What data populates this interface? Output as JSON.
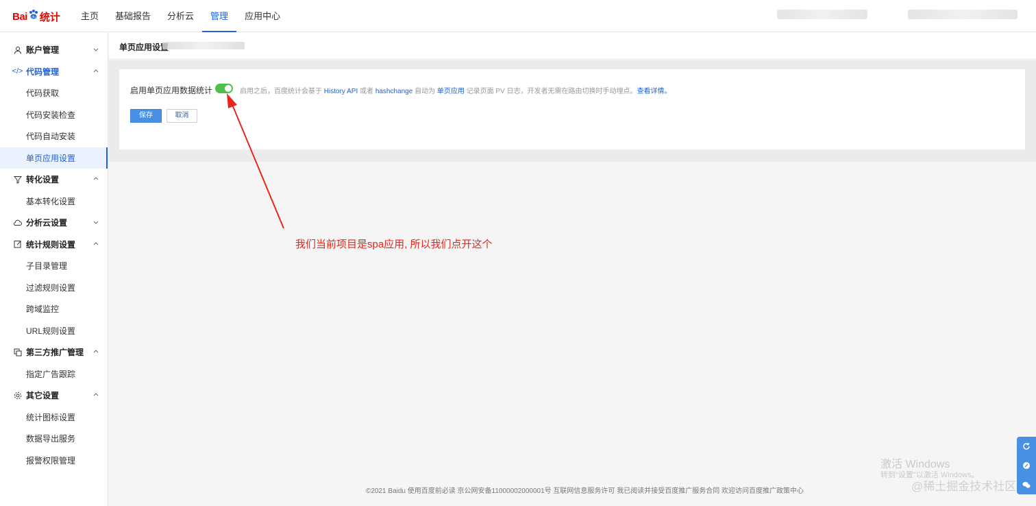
{
  "logo": {
    "left": "Bai",
    "right": "统计"
  },
  "nav": {
    "items": [
      "主页",
      "基础报告",
      "分析云",
      "管理",
      "应用中心"
    ],
    "active_index": 3
  },
  "sidebar": {
    "groups": [
      {
        "label": "账户管理",
        "icon": "user-icon",
        "expanded": false,
        "items": []
      },
      {
        "label": "代码管理",
        "icon": "code-icon",
        "expanded": true,
        "items": [
          "代码获取",
          "代码安装检查",
          "代码自动安装",
          "单页应用设置"
        ]
      },
      {
        "label": "转化设置",
        "icon": "filter-icon",
        "expanded": true,
        "items": [
          "基本转化设置"
        ]
      },
      {
        "label": "分析云设置",
        "icon": "cloud-icon",
        "expanded": false,
        "items": []
      },
      {
        "label": "统计规则设置",
        "icon": "edit-icon",
        "expanded": true,
        "items": [
          "子目录管理",
          "过滤规则设置",
          "跨域监控",
          "URL规则设置"
        ]
      },
      {
        "label": "第三方推广管理",
        "icon": "copy-icon",
        "expanded": true,
        "items": [
          "指定广告跟踪"
        ]
      },
      {
        "label": "其它设置",
        "icon": "gear-icon",
        "expanded": true,
        "items": [
          "统计图标设置",
          "数据导出服务",
          "报警权限管理"
        ]
      }
    ],
    "active_item": "单页应用设置"
  },
  "breadcrumb": "单页应用设置",
  "setting": {
    "label": "启用单页应用数据统计",
    "enabled": true,
    "desc_1": "启用之后，百度统计会基于 ",
    "link_1": "History API",
    "desc_2": " 或者 ",
    "link_2": "hashchange",
    "desc_3": " 自动为 ",
    "link_3": "单页应用",
    "desc_4": " 记录页面 PV 日志，开发者无需在路由切换时手动埋点。",
    "link_4": "查看详情。"
  },
  "buttons": {
    "save": "保存",
    "cancel": "取消"
  },
  "annotation": "我们当前项目是spa应用, 所以我们点开这个",
  "footer": "©2021 Baidu 使用百度前必读 京公网安备11000002000001号 互联网信息服务许可 我已阅读并接受百度推广服务合同 欢迎访问百度推广政策中心",
  "windows": {
    "line1": "激活 Windows",
    "line2": "转到\"设置\"以激活 Windows。"
  },
  "watermark": "@稀土掘金技术社区",
  "colors": {
    "accent": "#2262d6",
    "toggle_on": "#4fc04a",
    "annotation": "#e5261c"
  }
}
